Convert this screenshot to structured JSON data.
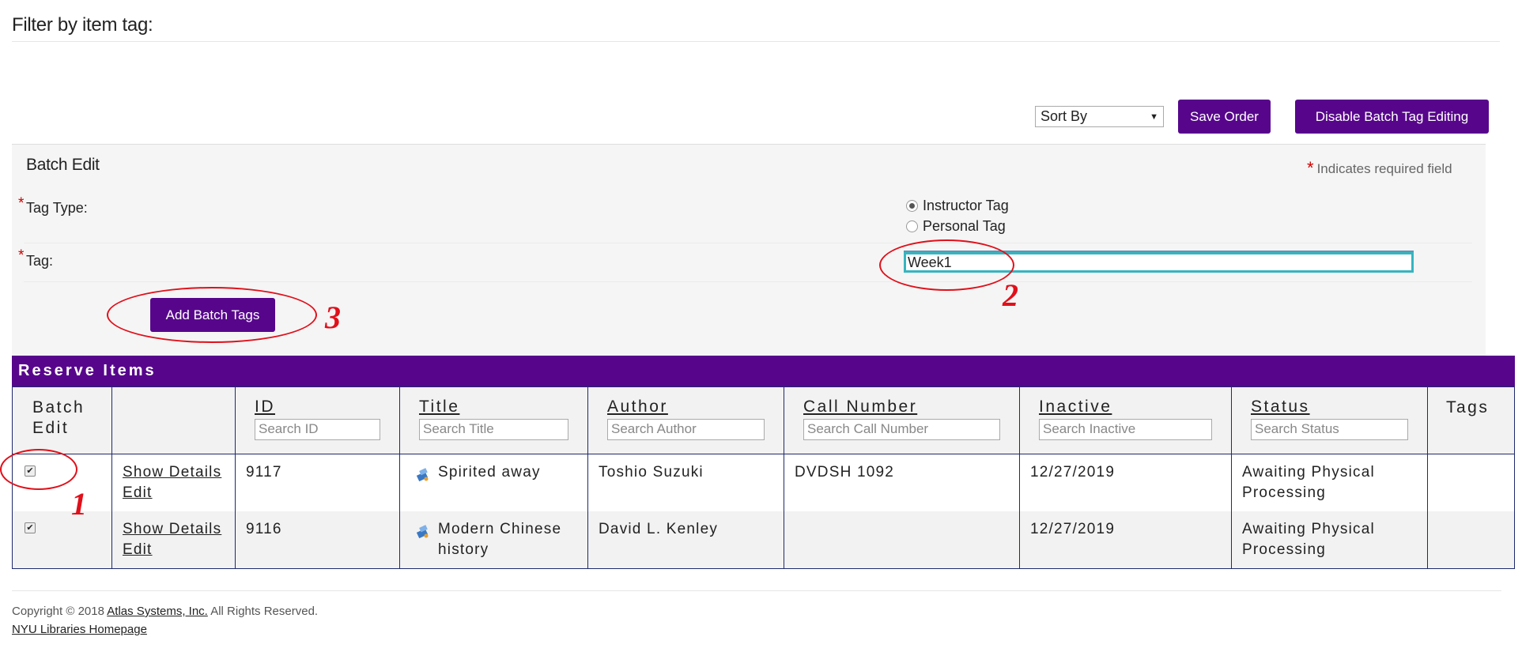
{
  "filter": {
    "heading": "Filter by item tag:"
  },
  "toolbar": {
    "sort_value": "Sort By",
    "save_order": "Save Order",
    "disable_batch": "Disable Batch Tag Editing"
  },
  "batch_edit": {
    "title": "Batch Edit",
    "required_star": "*",
    "required_note": "Indicates required field",
    "tag_type_label": "Tag Type:",
    "tag_label": "Tag:",
    "tag_type_options": [
      {
        "label": "Instructor Tag",
        "checked": true
      },
      {
        "label": "Personal Tag",
        "checked": false
      }
    ],
    "tag_value": "Week1",
    "add_button": "Add Batch Tags"
  },
  "annotations": {
    "one": "1",
    "two": "2",
    "three": "3"
  },
  "reserve_items": {
    "title": "Reserve Items",
    "columns": {
      "batch_edit_line1": "Batch",
      "batch_edit_line2": "Edit",
      "id": "ID",
      "title": "Title",
      "author": "Author",
      "call_number": "Call Number",
      "inactive": "Inactive",
      "status": "Status",
      "tags": "Tags"
    },
    "search_placeholders": {
      "id": "Search ID",
      "title": "Search Title",
      "author": "Search Author",
      "call_number": "Search Call Number",
      "inactive": "Search Inactive",
      "status": "Search Status"
    },
    "rows": [
      {
        "checked": true,
        "show_details": "Show Details",
        "edit": "Edit",
        "id": "9117",
        "title_line1": "Spirited away",
        "title_line2": "",
        "author": "Toshio Suzuki",
        "call_number": "DVDSH 1092",
        "inactive": "12/27/2019",
        "status_line1": "Awaiting Physical",
        "status_line2": "Processing",
        "tags": ""
      },
      {
        "checked": true,
        "show_details": "Show Details",
        "edit": "Edit",
        "id": "9116",
        "title_line1": "Modern Chinese",
        "title_line2": "history",
        "author": "David L. Kenley",
        "call_number": "",
        "inactive": "12/27/2019",
        "status_line1": "Awaiting Physical",
        "status_line2": "Processing",
        "tags": ""
      }
    ]
  },
  "footer": {
    "copyright_prefix": "Copyright © 2018",
    "company_link": "Atlas Systems, Inc.",
    "copyright_suffix": "All Rights Reserved.",
    "nyu_link": "NYU Libraries Homepage"
  },
  "colors": {
    "brand_purple": "#57068c",
    "annotation_red": "#e0101a",
    "input_focus": "#36b5c0"
  }
}
